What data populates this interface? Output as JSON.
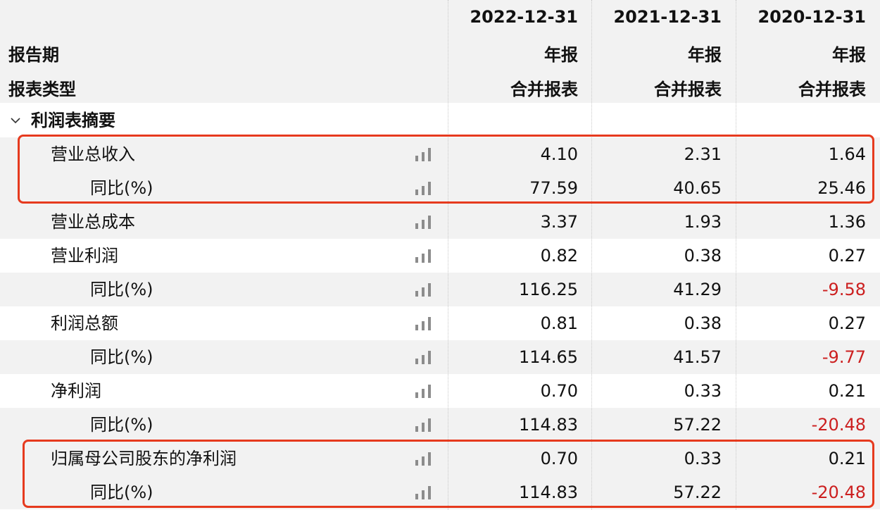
{
  "header": {
    "period_label": "报告期",
    "type_label": "报表类型",
    "columns": [
      {
        "date": "2022-12-31",
        "period": "年报",
        "type": "合并报表"
      },
      {
        "date": "2021-12-31",
        "period": "年报",
        "type": "合并报表"
      },
      {
        "date": "2020-12-31",
        "period": "年报",
        "type": "合并报表"
      }
    ]
  },
  "section": {
    "toggle_icon": "chevron-down",
    "title": "利润表摘要"
  },
  "rows": [
    {
      "label": "营业总收入",
      "values": [
        "4.10",
        "2.31",
        "1.64"
      ]
    },
    {
      "label": "同比(%)",
      "values": [
        "77.59",
        "40.65",
        "25.46"
      ]
    },
    {
      "label": "营业总成本",
      "values": [
        "3.37",
        "1.93",
        "1.36"
      ]
    },
    {
      "label": "营业利润",
      "values": [
        "0.82",
        "0.38",
        "0.27"
      ]
    },
    {
      "label": "同比(%)",
      "values": [
        "116.25",
        "41.29",
        "-9.58"
      ]
    },
    {
      "label": "利润总额",
      "values": [
        "0.81",
        "0.38",
        "0.27"
      ]
    },
    {
      "label": "同比(%)",
      "values": [
        "114.65",
        "41.57",
        "-9.77"
      ]
    },
    {
      "label": "净利润",
      "values": [
        "0.70",
        "0.33",
        "0.21"
      ]
    },
    {
      "label": "同比(%)",
      "values": [
        "114.83",
        "57.22",
        "-20.48"
      ]
    },
    {
      "label": "归属母公司股东的净利润",
      "values": [
        "0.70",
        "0.33",
        "0.21"
      ]
    },
    {
      "label": "同比(%)",
      "values": [
        "114.83",
        "57.22",
        "-20.48"
      ]
    }
  ],
  "colors": {
    "negative": "#cc1f1f",
    "highlight_border": "#e63a1e",
    "header_bg": "#f2f2f2"
  }
}
